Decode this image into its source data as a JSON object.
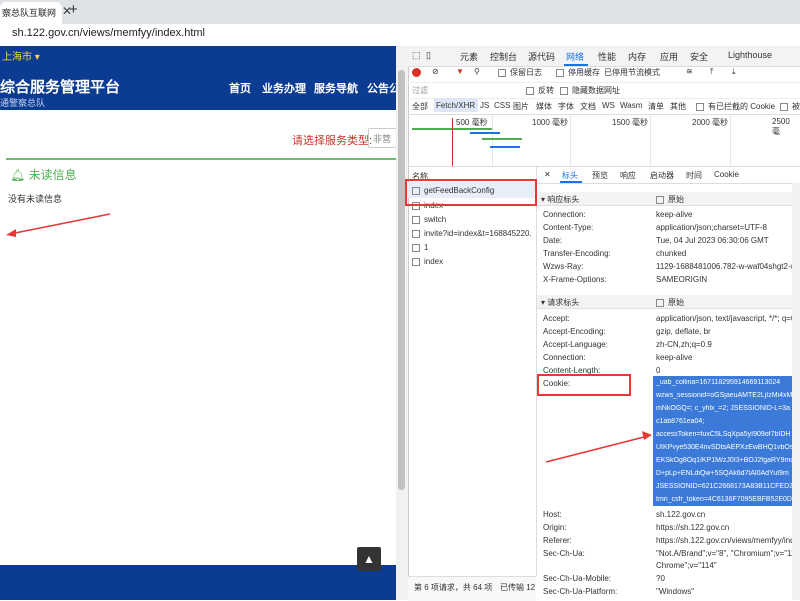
{
  "browser": {
    "tab_title": "察总队互联网",
    "url": "sh.122.gov.cn/views/memfyy/index.html"
  },
  "site": {
    "city": "上海市 ▾",
    "title": "综合服务管理平台",
    "subtitle": "通警察总队",
    "nav": [
      "首页",
      "业务办理",
      "服务导航",
      "公告公"
    ],
    "service_label": "请选择服务类型:",
    "service_placeholder": "非营",
    "unread_title": "未读信息",
    "no_unread": "没有未读信息",
    "top_button": "▲"
  },
  "devtools": {
    "tabs": [
      "元素",
      "控制台",
      "源代码",
      "网络",
      "性能",
      "内存",
      "应用",
      "安全",
      "Lighthouse"
    ],
    "active_tab": "网络",
    "toolbar1": [
      "保留日志",
      "停用缓存",
      "已停用节流模式"
    ],
    "filter_placeholder": "过滤",
    "toolbar2": [
      "反转",
      "隐藏数据网址"
    ],
    "type_filters": [
      "全部",
      "Fetch/XHR",
      "JS",
      "CSS",
      "图片",
      "媒体",
      "字体",
      "文档",
      "WS",
      "Wasm",
      "清单",
      "其他"
    ],
    "blocked_cookie": "有已拦截的 Cookie",
    "blocked_more": "被",
    "timeline_labels": [
      "500 毫秒",
      "1000 毫秒",
      "1500 毫秒",
      "2000 毫秒",
      "2500 毫"
    ],
    "name_header": "名称",
    "requests": [
      "getFeedBackConfig",
      "index",
      "switch",
      "invite?id=index&t=168845220...",
      "1",
      "index"
    ],
    "status": "第 6 项请求，共 64 项",
    "status_extra": "已传输 12",
    "detail_tabs": [
      "标头",
      "预览",
      "响应",
      "启动器",
      "时间",
      "Cookie"
    ],
    "active_detail_tab": "标头",
    "close": "✕",
    "response_section": "▾ 响应标头",
    "request_section": "▾ 请求标头",
    "raw": "原始",
    "response_headers": [
      {
        "k": "Connection:",
        "v": "keep-alive"
      },
      {
        "k": "Content-Type:",
        "v": "application/json;charset=UTF-8"
      },
      {
        "k": "Date:",
        "v": "Tue, 04 Jul 2023 06:30:06 GMT"
      },
      {
        "k": "Transfer-Encoding:",
        "v": "chunked"
      },
      {
        "k": "Wzws-Ray:",
        "v": "1129-1688481006.782-w-waf04shgt2-w-w"
      },
      {
        "k": "X-Frame-Options:",
        "v": "SAMEORIGIN"
      }
    ],
    "request_headers_top": [
      {
        "k": "Accept:",
        "v": "application/json, text/javascript, */*; q=0.0"
      },
      {
        "k": "Accept-Encoding:",
        "v": "gzip, deflate, br"
      },
      {
        "k": "Accept-Language:",
        "v": "zh-CN,zh;q=0.9"
      },
      {
        "k": "Connection:",
        "v": "keep-alive"
      },
      {
        "k": "Content-Length:",
        "v": "0"
      },
      {
        "k": "Cookie:",
        "v": ""
      }
    ],
    "cookie_lines": [
      "_uab_collina=167118295914669113024",
      "wzws_sessionid=oGSjaeuAMTE2LjIzMi4xM",
      "mNkOGQ=; c_yhlx_=2; JSESSIONID-L=3a",
      "c1ab8761ea04;",
      "accessToken=fuxC5LSqXpa5yI909of7bIDH",
      "UIKPvye530E4nvSDtsAEPXzEwBHQ1vbOs8",
      "EKSkOg8Oq1IKP1M/zJ0I3+BOJ2fgaRY9mc",
      "D+pLp+ENLdiQw+5SQAk6d7tAl0AdYuI9m",
      "JSESSIONID=621C2668173A83B11CFED34",
      "tmri_csfr_token=4C6136F7095EBFB52E0D"
    ],
    "request_headers_bottom": [
      {
        "k": "Host:",
        "v": "sh.122.gov.cn"
      },
      {
        "k": "Origin:",
        "v": "https://sh.122.gov.cn"
      },
      {
        "k": "Referer:",
        "v": "https://sh.122.gov.cn/views/memfyy/index"
      },
      {
        "k": "Sec-Ch-Ua:",
        "v": "\"Not.A/Brand\";v=\"8\", \"Chromium\";v=\"114\""
      },
      {
        "k": "",
        "v": "Chrome\";v=\"114\""
      },
      {
        "k": "Sec-Ch-Ua-Mobile:",
        "v": "?0"
      },
      {
        "k": "Sec-Ch-Ua-Platform:",
        "v": "\"Windows\""
      }
    ]
  }
}
